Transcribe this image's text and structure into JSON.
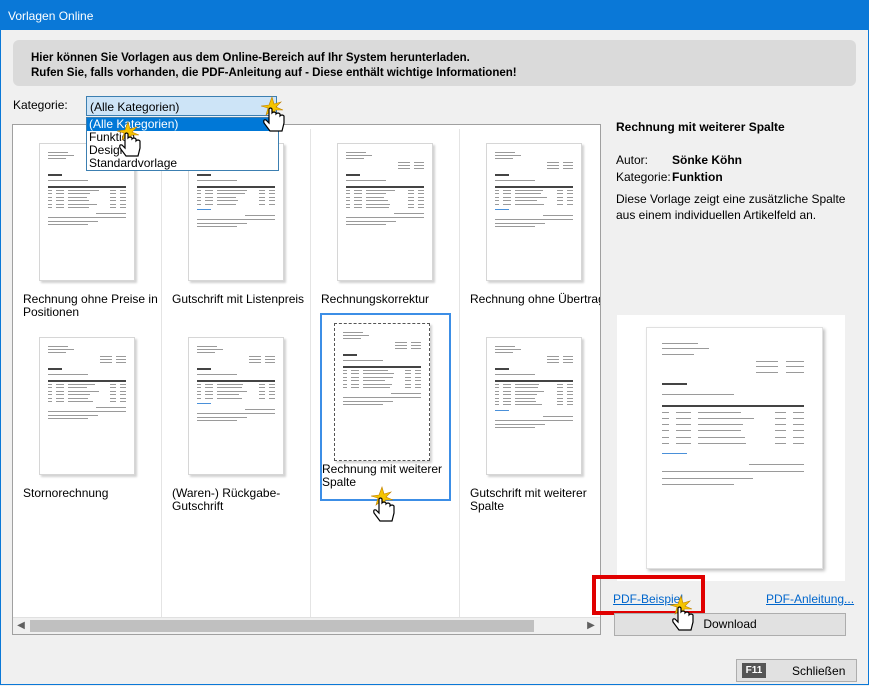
{
  "window": {
    "title": "Vorlagen Online"
  },
  "banner": {
    "line1": "Hier können Sie Vorlagen aus dem Online-Bereich auf Ihr System herunterladen.",
    "line2": "Rufen Sie, falls vorhanden, die PDF-Anleitung auf - Diese enthält wichtige Informationen!"
  },
  "category": {
    "label": "Kategorie:",
    "selected": "(Alle Kategorien)",
    "options": [
      "(Alle Kategorien)",
      "Funktion",
      "Design",
      "Standardvorlage"
    ]
  },
  "templates": [
    {
      "label": "Rechnung ohne Preise in Positionen"
    },
    {
      "label": "Gutschrift mit Listenpreis"
    },
    {
      "label": "Rechnungskorrektur"
    },
    {
      "label": "Rechnung ohne Übertrag"
    },
    {
      "label": "Stornorechnung"
    },
    {
      "label": "(Waren-) Rückgabe-Gutschrift"
    },
    {
      "label": "Rechnung mit weiterer Spalte"
    },
    {
      "label": "Gutschrift mit weiterer Spalte"
    }
  ],
  "detail": {
    "title": "Rechnung mit weiterer Spalte",
    "author_label": "Autor:",
    "author": "Sönke Köhn",
    "category_label": "Kategorie:",
    "category": "Funktion",
    "description": "Diese Vorlage zeigt eine zusätzliche Spalte aus einem individuellen Artikelfeld an."
  },
  "links": {
    "pdf_example": "PDF-Beispiel",
    "pdf_manual": "PDF-Anleitung..."
  },
  "buttons": {
    "download": "Download",
    "close_key": "F11",
    "close": "Schließen"
  },
  "colors": {
    "titlebar": "#0a78d7",
    "selection": "#0078d7",
    "highlight_box": "#e00000",
    "link": "#0066cc"
  },
  "icons": {
    "cursor": "hand-pointer-icon"
  }
}
